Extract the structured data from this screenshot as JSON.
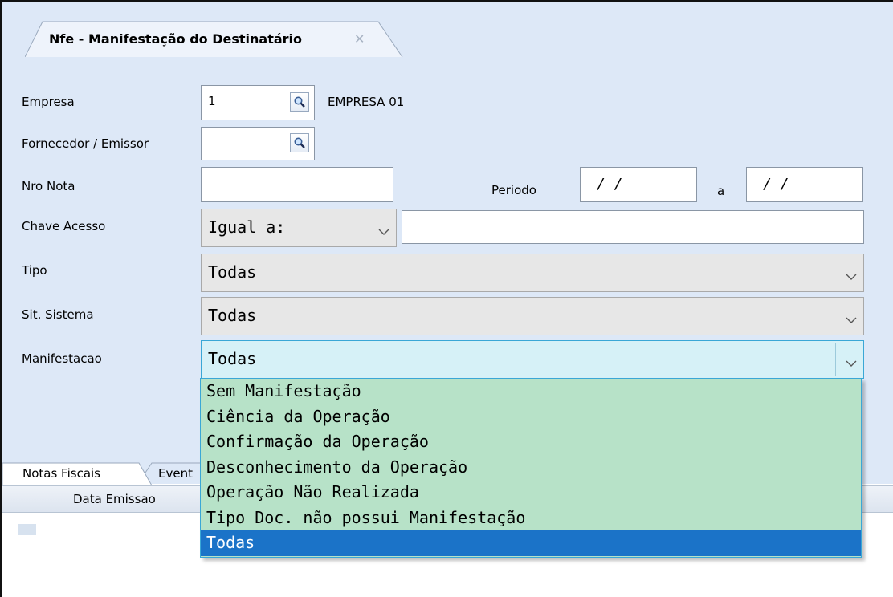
{
  "window": {
    "tab_title": "Nfe - Manifestação do Destinatário",
    "close_icon": "close-icon"
  },
  "form": {
    "empresa": {
      "label": "Empresa",
      "value": "1",
      "description": "EMPRESA 01"
    },
    "fornecedor": {
      "label": "Fornecedor / Emissor",
      "value": ""
    },
    "nro_nota": {
      "label": "Nro Nota",
      "value": ""
    },
    "periodo": {
      "label": "Periodo",
      "from": "/ /",
      "separator": "a",
      "to": "/ /"
    },
    "chave_acesso": {
      "label": "Chave Acesso",
      "operator": "Igual a:",
      "value": ""
    },
    "tipo": {
      "label": "Tipo",
      "value": "Todas"
    },
    "sit_sistema": {
      "label": "Sit. Sistema",
      "value": "Todas"
    },
    "manifestacao": {
      "label": "Manifestacao",
      "value": "Todas",
      "options": [
        "Sem Manifestação",
        "Ciência da Operação",
        "Confirmação da Operação",
        "Desconhecimento da Operação",
        "Operação Não Realizada",
        "Tipo Doc. não possui Manifestação",
        "Todas"
      ],
      "selected_index": 6
    }
  },
  "bottom_tabs": [
    {
      "label": "Notas Fiscais"
    },
    {
      "label": "Event"
    }
  ],
  "grid": {
    "columns": [
      "Data Emissao"
    ]
  },
  "colors": {
    "panel_bg": "#dde8f7",
    "dropdown_bg": "#b7e2c8",
    "selected_bg": "#1b73c8",
    "active_border": "#3aa7d6"
  }
}
